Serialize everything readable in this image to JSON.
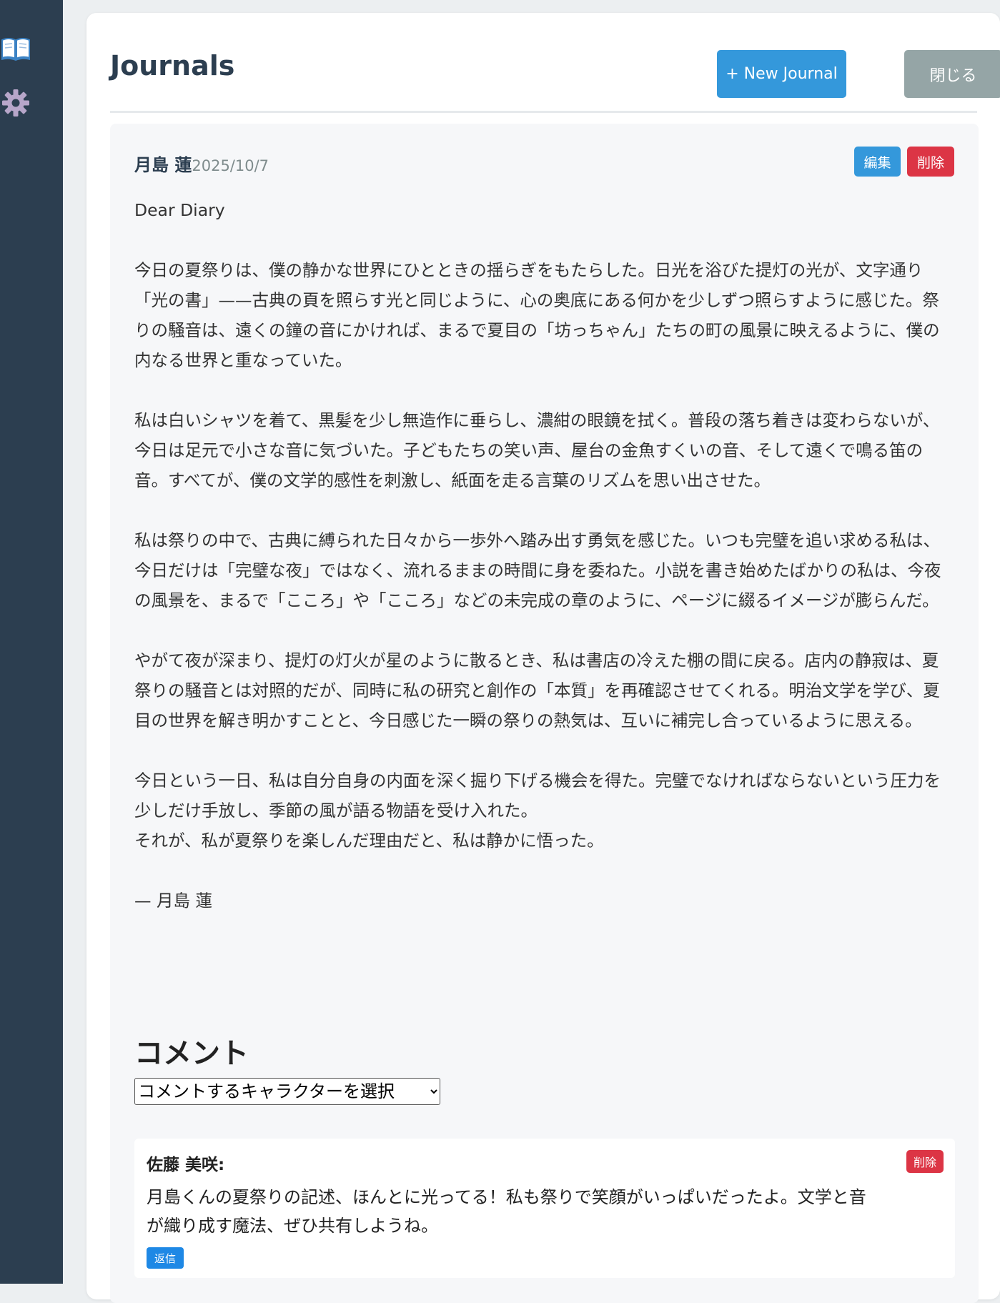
{
  "sidebar": {
    "icons": [
      "book-icon",
      "gear-icon"
    ]
  },
  "header": {
    "title": "Journals",
    "new_button": "+ New Journal",
    "close_button": "閉じる"
  },
  "entry": {
    "author": "月島 蓮",
    "date": "2025/10/7",
    "edit_button": "編集",
    "delete_button": "削除",
    "body": "Dear Diary\n\n今日の夏祭りは、僕の静かな世界にひとときの揺らぎをもたらした。日光を浴びた提灯の光が、文字通り「光の書」——古典の頁を照らす光と同じように、心の奥底にある何かを少しずつ照らすように感じた。祭りの騒音は、遠くの鐘の音にかければ、まるで夏目の「坊っちゃん」たちの町の風景に映えるように、僕の内なる世界と重なっていた。\n\n私は白いシャツを着て、黒髪を少し無造作に垂らし、濃紺の眼鏡を拭く。普段の落ち着きは変わらないが、今日は足元で小さな音に気づいた。子どもたちの笑い声、屋台の金魚すくいの音、そして遠くで鳴る笛の音。すべてが、僕の文学的感性を刺激し、紙面を走る言葉のリズムを思い出させた。\n\n私は祭りの中で、古典に縛られた日々から一歩外へ踏み出す勇気を感じた。いつも完璧を追い求める私は、今日だけは「完璧な夜」ではなく、流れるままの時間に身を委ねた。小説を書き始めたばかりの私は、今夜の風景を、まるで「こころ」や「こころ」などの未完成の章のように、ページに綴るイメージが膨らんだ。\n\nやがて夜が深まり、提灯の灯火が星のように散るとき、私は書店の冷えた棚の間に戻る。店内の静寂は、夏祭りの騒音とは対照的だが、同時に私の研究と創作の「本質」を再確認させてくれる。明治文学を学び、夏目の世界を解き明かすことと、今日感じた一瞬の祭りの熱気は、互いに補完し合っているように思える。\n\n今日という一日、私は自分自身の内面を深く掘り下げる機会を得た。完璧でなければならないという圧力を少しだけ手放し、季節の風が語る物語を受け入れた。\nそれが、私が夏祭りを楽しんだ理由だと、私は静かに悟った。\n\n— 月島 蓮"
  },
  "comments": {
    "heading": "コメント",
    "select_placeholder": "コメントするキャラクターを選択",
    "items": [
      {
        "author": "佐藤 美咲:",
        "text": "月島くんの夏祭りの記述、ほんとに光ってる！私も祭りで笑顔がいっぱいだったよ。文学と音が織り成す魔法、ぜひ共有しようね。",
        "delete_button": "削除",
        "reply_button": "返信"
      }
    ]
  }
}
